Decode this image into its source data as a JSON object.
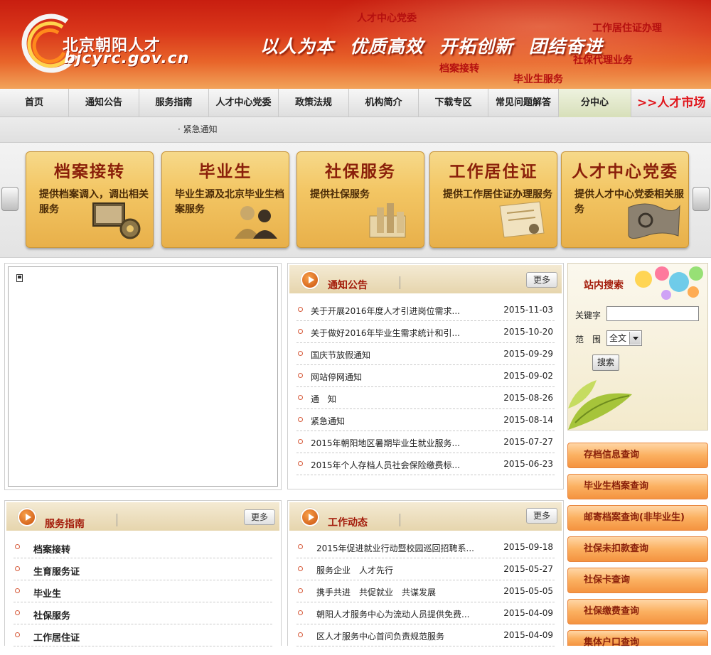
{
  "header": {
    "logo_text": "北京朝阳人才",
    "logo_domain": "bjcyrc.gov.cn",
    "slogans": [
      "以人为本",
      "优质高效",
      "开拓创新",
      "团结奋进"
    ],
    "tags": {
      "party": "人才中心党委",
      "residence": "工作居住证办理",
      "social": "社保代理业务",
      "archive": "档案接转",
      "graduate": "毕业生服务"
    }
  },
  "nav": {
    "items": [
      "首页",
      "通知公告",
      "服务指南",
      "人才中心党委",
      "政策法规",
      "机构简介",
      "下载专区",
      "常见问题解答",
      "分中心"
    ],
    "market": ">>人才市场"
  },
  "ticker": {
    "text": "· 紧急通知"
  },
  "services": [
    {
      "title": "档案接转",
      "desc": "提供档案调入，调出相关服务",
      "icon": "computer-gear-icon"
    },
    {
      "title": "毕业生",
      "desc": "毕业生源及北京毕业生档案服务",
      "icon": "graduate-people-icon"
    },
    {
      "title": "社保服务",
      "desc": "提供社保服务",
      "icon": "social-security-icon"
    },
    {
      "title": "工作居住证",
      "desc": "提供工作居住证办理服务",
      "icon": "permit-document-icon"
    },
    {
      "title": "人才中心党委",
      "desc": "提供人才中心党委相关服务",
      "icon": "party-flag-icon"
    }
  ],
  "notices": {
    "title": "通知公告",
    "more": "更多",
    "items": [
      {
        "title": "关于开展2016年度人才引进岗位需求...",
        "date": "2015-11-03"
      },
      {
        "title": "关于做好2016年毕业生需求统计和引...",
        "date": "2015-10-20"
      },
      {
        "title": "国庆节放假通知",
        "date": "2015-09-29"
      },
      {
        "title": "网站停网通知",
        "date": "2015-09-02"
      },
      {
        "title": "通　知",
        "date": "2015-08-26"
      },
      {
        "title": "紧急通知",
        "date": "2015-08-14"
      },
      {
        "title": "2015年朝阳地区暑期毕业生就业服务...",
        "date": "2015-07-27"
      },
      {
        "title": "2015年个人存档人员社会保险缴费标...",
        "date": "2015-06-23"
      }
    ]
  },
  "guide": {
    "title": "服务指南",
    "more": "更多",
    "items": [
      "档案接转",
      "生育服务证",
      "毕业生",
      "社保服务",
      "工作居住证"
    ]
  },
  "news": {
    "title": "工作动态",
    "more": "更多",
    "items": [
      {
        "title": "2015年促进就业行动暨校园巡回招聘系...",
        "date": "2015-09-18"
      },
      {
        "title": "服务企业　人才先行",
        "date": "2015-05-27"
      },
      {
        "title": "携手共进　共促就业　共谋发展",
        "date": "2015-05-05"
      },
      {
        "title": "朝阳人才服务中心为流动人员提供免费...",
        "date": "2015-04-09"
      },
      {
        "title": "区人才服务中心首问负责规范服务",
        "date": "2015-04-09"
      }
    ]
  },
  "search": {
    "title": "站内搜索",
    "keyword_label": "关键字",
    "keyword_value": "",
    "scope_label": "范　围",
    "scope_selected": "全文",
    "button": "搜索"
  },
  "quick_links": [
    "存档信息查询",
    "毕业生档案查询",
    "邮寄档案查询(非毕业生)",
    "社保未扣款查询",
    "社保卡查询",
    "社保缴费查询",
    "集体户口查询"
  ],
  "colors": {
    "header_red": "#c81e10",
    "title_red": "#a31b0a",
    "market_red": "#e0141a",
    "gold": "#f3c664",
    "orange_button": "#f49340"
  }
}
